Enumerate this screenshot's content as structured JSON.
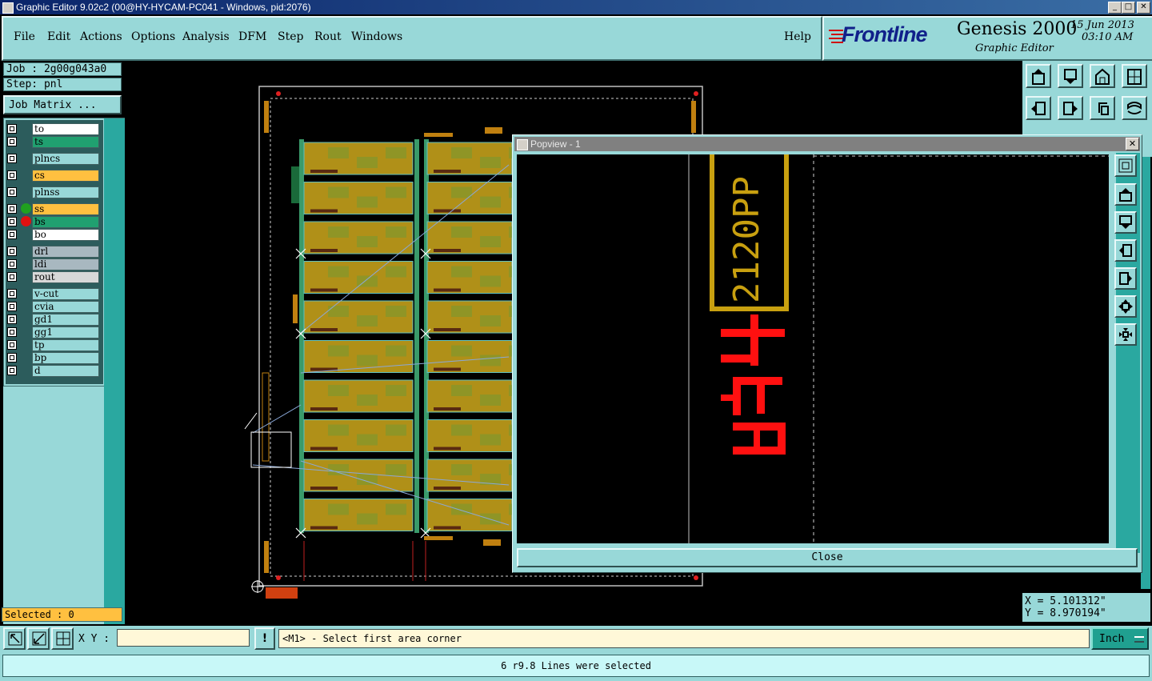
{
  "window": {
    "title": "Graphic Editor 9.02c2 (00@HY-HYCAM-PC041 - Windows, pid:2076)",
    "controls": [
      "_",
      "□",
      "✕"
    ]
  },
  "menu": {
    "items": [
      "File",
      "Edit",
      "Actions",
      "Options",
      "Analysis",
      "DFM",
      "Step",
      "Rout",
      "Windows"
    ],
    "help": "Help"
  },
  "brand": {
    "logo": "Frontline",
    "product": "Genesis 2000",
    "module": "Graphic Editor",
    "date": "15 Jun 2013",
    "time": "03:10 AM"
  },
  "job": {
    "job_label": "Job : 2g00g043a0",
    "step_label": "Step: pnl",
    "matrix_button": "Job Matrix ..."
  },
  "layers": [
    {
      "name": "to",
      "color": "#ffffff"
    },
    {
      "name": "ts",
      "color": "#20a070"
    },
    {
      "name": "plncs",
      "color": "#98d8d8"
    },
    {
      "name": "cs",
      "color": "#ffc040"
    },
    {
      "name": "plnss",
      "color": "#98d8d8"
    },
    {
      "name": "ss",
      "color": "#ffc040"
    },
    {
      "name": "bs",
      "color": "#20a070"
    },
    {
      "name": "bo",
      "color": "#ffffff"
    },
    {
      "name": "drl",
      "color": "#a8b8c0"
    },
    {
      "name": "ldi",
      "color": "#a8b8c0"
    },
    {
      "name": "rout",
      "color": "#d8d8d8"
    },
    {
      "name": "v-cut",
      "color": "#98d8d8"
    },
    {
      "name": "cvia",
      "color": "#98d8d8"
    },
    {
      "name": "gd1",
      "color": "#98d8d8"
    },
    {
      "name": "gg1",
      "color": "#98d8d8"
    },
    {
      "name": "tp",
      "color": "#98d8d8"
    },
    {
      "name": "bp",
      "color": "#98d8d8"
    },
    {
      "name": "d",
      "color": "#98d8d8"
    }
  ],
  "status": {
    "selected": "Selected : 0",
    "xy_label": "X Y :",
    "xy_value": "",
    "prompt": "<M1> - Select first area corner",
    "units": "Inch",
    "message": "6 r9.8 Lines were selected",
    "coord_x": "X  =  5.101312\"",
    "coord_y": "Y  =  8.970194\""
  },
  "popview": {
    "title": "Popview - 1",
    "close_button": "Close",
    "board_text": "2120PP 3"
  },
  "icons": {
    "toolbar": [
      "home-icon",
      "zoom-in-icon",
      "house-icon",
      "window-icon",
      "pan-left-icon",
      "pan-right-icon",
      "undo-icon",
      "redo-icon"
    ],
    "popview_tools": [
      "zoom-fit-icon",
      "pan-up-icon",
      "pan-down-icon",
      "pan-left-icon",
      "pan-right-icon",
      "zoom-in-icon",
      "zoom-out-icon"
    ]
  }
}
